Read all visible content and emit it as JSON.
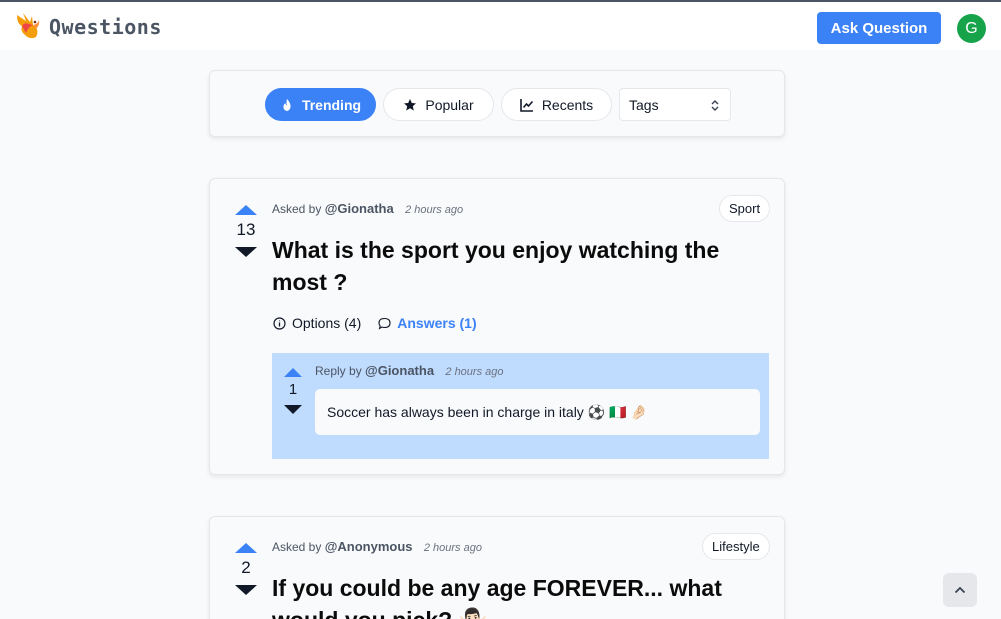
{
  "app": {
    "brand": "Qwestions"
  },
  "header": {
    "ask_label": "Ask Question",
    "avatar_initial": "G"
  },
  "filters": {
    "tabs": [
      {
        "label": "Trending",
        "icon": "flame-icon",
        "active": true
      },
      {
        "label": "Popular",
        "icon": "star-icon",
        "active": false
      },
      {
        "label": "Recents",
        "icon": "chart-line-icon",
        "active": false
      }
    ],
    "tags_select": {
      "selected": "Tags"
    }
  },
  "questions": [
    {
      "asked_prefix": "Asked by",
      "author": "@Gionatha",
      "time": "2 hours ago",
      "votes": "13",
      "tag": "Sport",
      "title": "What is the sport you enjoy watching the most ?",
      "options_label": "Options (4)",
      "answers_label": "Answers (1)",
      "reply": {
        "prefix": "Reply by",
        "author": "@Gionatha",
        "time": "2 hours ago",
        "votes": "1",
        "text": "Soccer has always been in charge in italy ⚽️ 🇮🇹 🤌🏻"
      }
    },
    {
      "asked_prefix": "Asked by",
      "author": "@Anonymous",
      "time": "2 hours ago",
      "votes": "2",
      "tag": "Lifestyle",
      "title": "If you could be any age FOREVER... what would you pick? 🤷🏻‍♂️"
    }
  ],
  "colors": {
    "accent": "#3b82f6",
    "reply_bg": "#bfdbfe",
    "avatar": "#16a34a"
  }
}
